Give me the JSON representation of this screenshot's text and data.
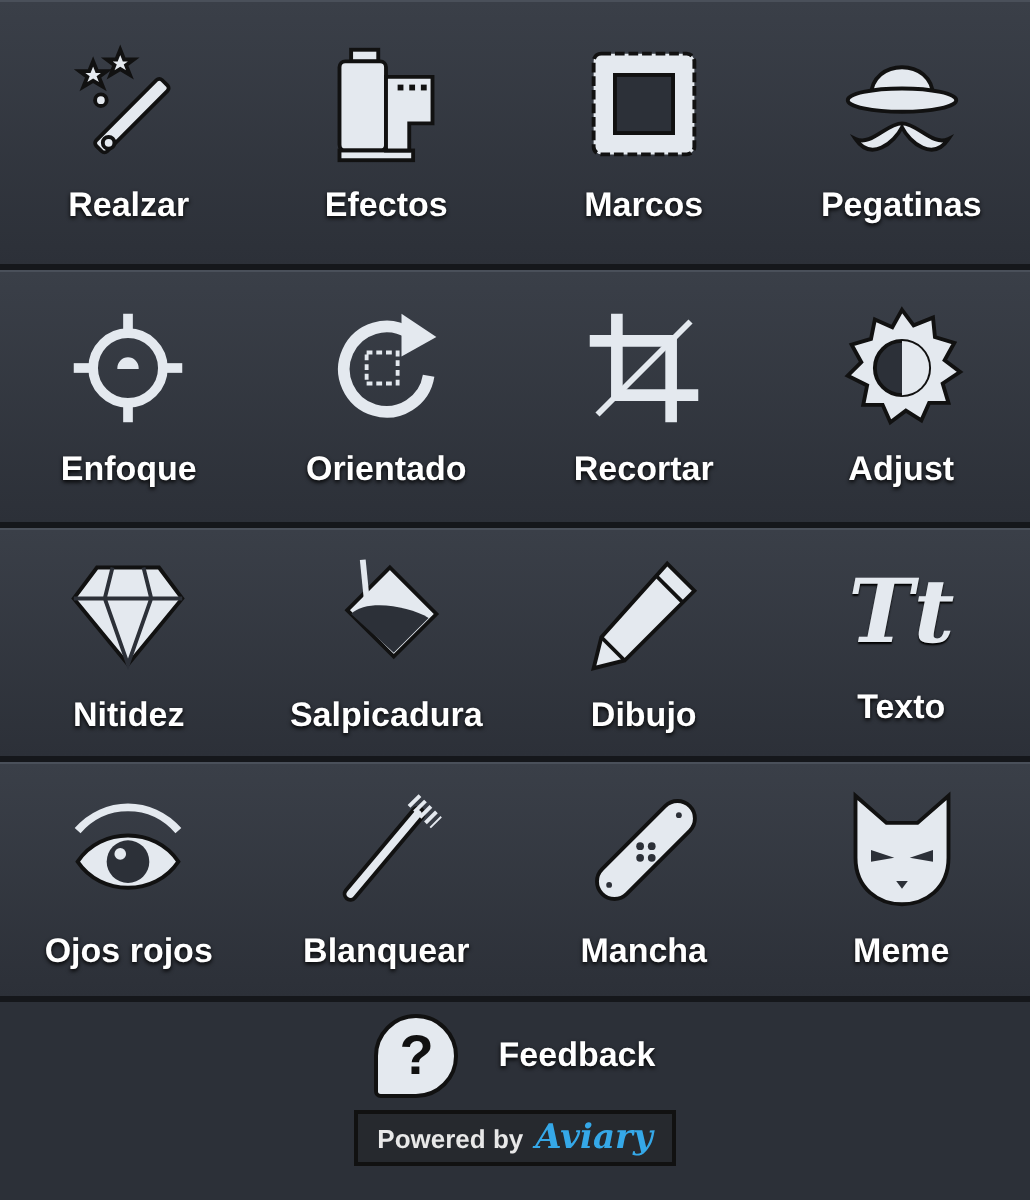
{
  "rows": [
    {
      "tools": [
        {
          "label": "Realzar"
        },
        {
          "label": "Efectos"
        },
        {
          "label": "Marcos"
        },
        {
          "label": "Pegatinas"
        }
      ]
    },
    {
      "tools": [
        {
          "label": "Enfoque"
        },
        {
          "label": "Orientado"
        },
        {
          "label": "Recortar"
        },
        {
          "label": "Adjust"
        }
      ]
    },
    {
      "tools": [
        {
          "label": "Nitidez"
        },
        {
          "label": "Salpicadura"
        },
        {
          "label": "Dibujo"
        },
        {
          "label": "Texto",
          "glyph": "Tt"
        }
      ]
    },
    {
      "tools": [
        {
          "label": "Ojos rojos"
        },
        {
          "label": "Blanquear"
        },
        {
          "label": "Mancha"
        },
        {
          "label": "Meme"
        }
      ]
    }
  ],
  "feedback": {
    "glyph": "?",
    "label": "Feedback"
  },
  "badge": {
    "prefix": "Powered by",
    "brand": "Aviary"
  }
}
